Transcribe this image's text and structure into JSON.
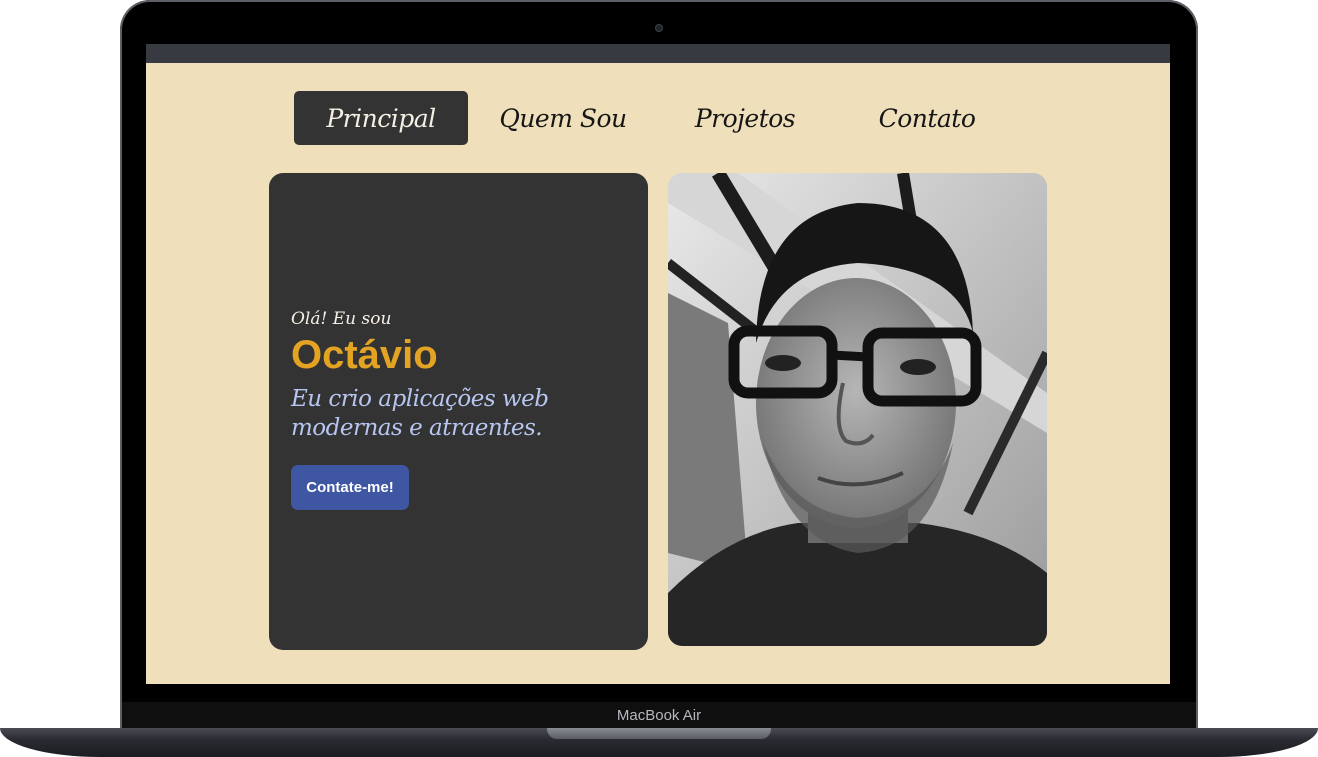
{
  "device": {
    "model_label": "MacBook Air"
  },
  "nav": {
    "items": [
      {
        "label": "Principal",
        "active": true
      },
      {
        "label": "Quem Sou",
        "active": false
      },
      {
        "label": "Projetos",
        "active": false
      },
      {
        "label": "Contato",
        "active": false
      }
    ]
  },
  "hero": {
    "greeting": "Olá! Eu sou",
    "name": "Octávio",
    "tagline_line1": "Eu crio aplicações web",
    "tagline_line2": "modernas e atraentes.",
    "cta_label": "Contate-me!"
  },
  "colors": {
    "page_background": "#efe0bb",
    "card": "#333333",
    "name_accent": "#e3a323",
    "tagline": "#b7c6f1",
    "button": "#3f57a3"
  },
  "icons": {
    "photo": "portrait-photo"
  }
}
